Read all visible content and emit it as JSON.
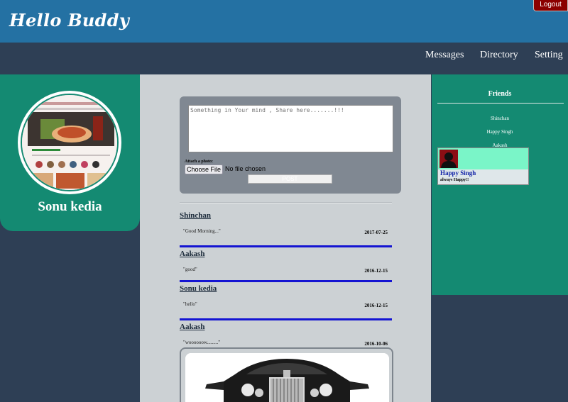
{
  "app": {
    "brand": "Hello Buddy",
    "logout_label": "Logout"
  },
  "nav": {
    "items": [
      {
        "label": "Messages"
      },
      {
        "label": "Directory"
      },
      {
        "label": "Setting"
      }
    ]
  },
  "profile": {
    "name": "Sonu kedia"
  },
  "compose": {
    "placeholder": "Something in Your mind , Share here.......!!!",
    "attach_label": "Attach a photo:",
    "choose_file_label": "Choose File",
    "no_file_label": "No file chosen",
    "post_label": "POST"
  },
  "posts": [
    {
      "author": "Shinchan",
      "text": "\"Good Morning...\"",
      "date": "2017-07-25"
    },
    {
      "author": "Aakash",
      "text": "\"good\"",
      "date": "2016-12-15"
    },
    {
      "author": "Sonu kedia",
      "text": "\"hello\"",
      "date": "2016-12-15"
    },
    {
      "author": "Aakash",
      "text": "\"woooooow.........\"",
      "date": "2016-10-06"
    }
  ],
  "friends": {
    "title": "Friends",
    "items": [
      {
        "name": "Shinchan"
      },
      {
        "name": "Happy Singh"
      },
      {
        "name": "Aakash"
      }
    ],
    "hover_card": {
      "name": "Happy Singh",
      "status": "always Happy!!"
    }
  },
  "colors": {
    "topbar": "#2471a3",
    "navbar": "#2e3f55",
    "panel_green": "#148a72",
    "feed_bg": "#ccd1d4",
    "post_separator": "#1414d2",
    "logout_red": "#8b0000",
    "card_mint": "#7af5c8"
  }
}
